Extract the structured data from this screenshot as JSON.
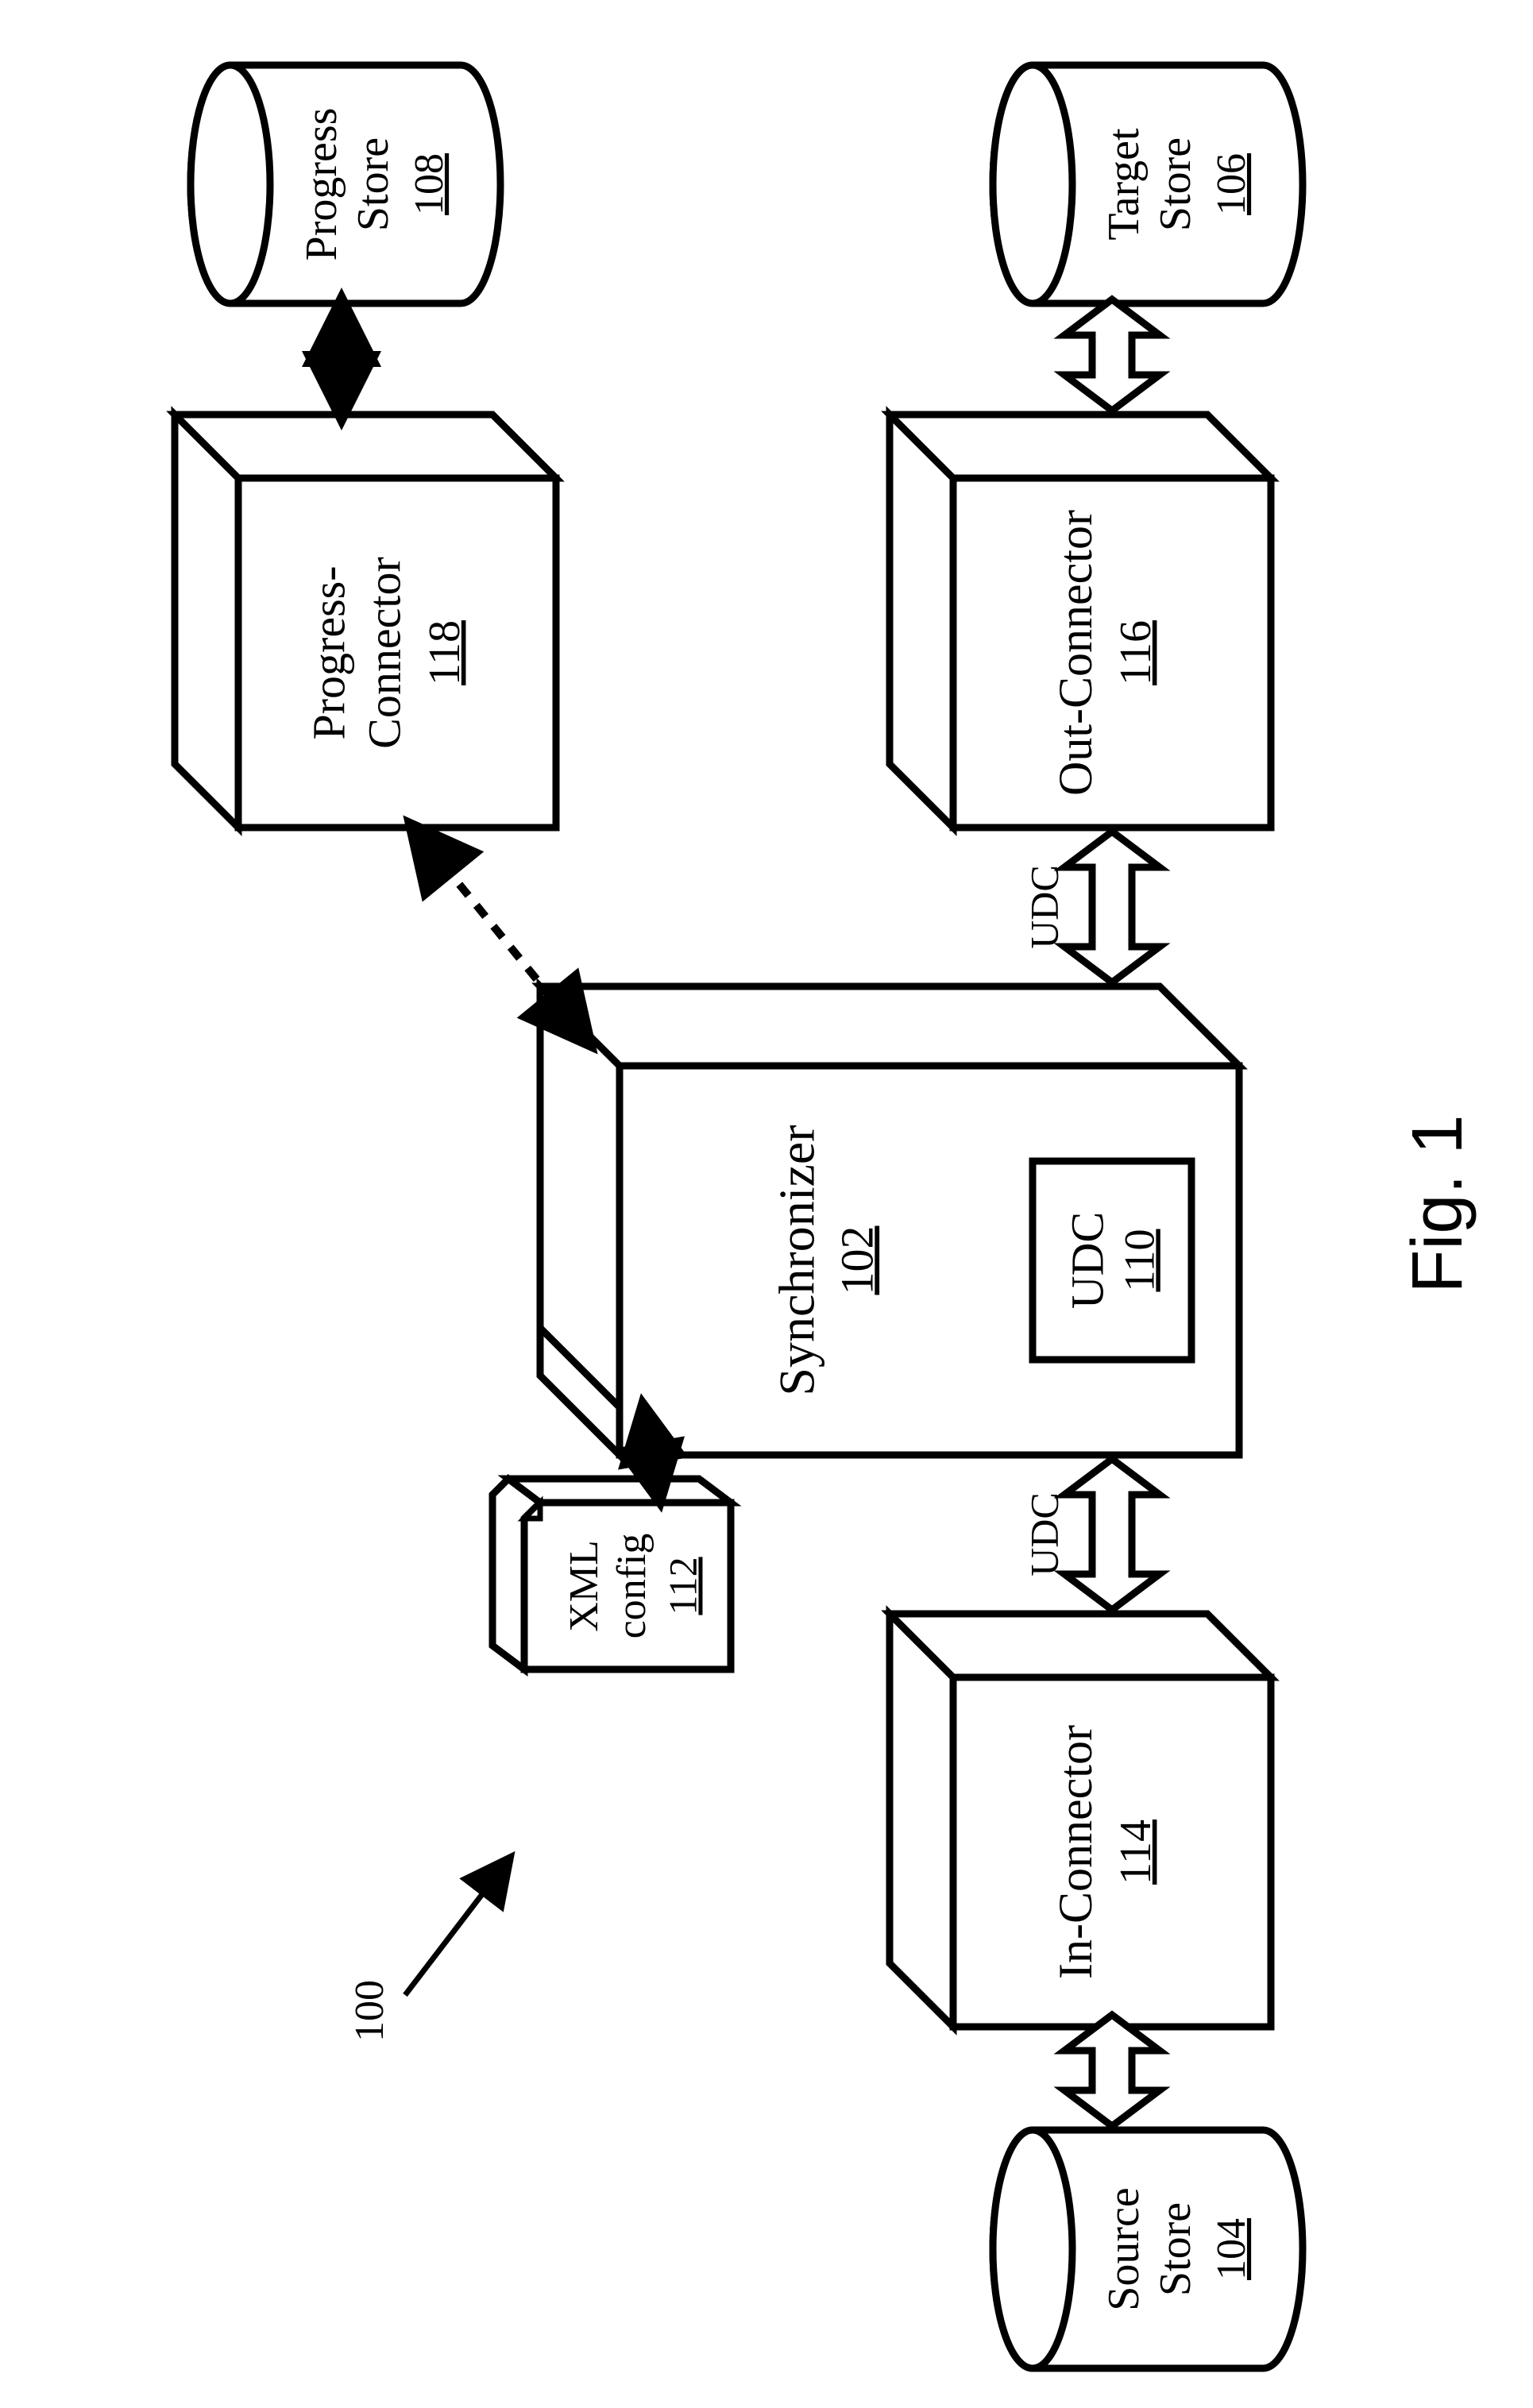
{
  "figure": {
    "caption": "Fig. 1",
    "ref_number": "100"
  },
  "nodes": {
    "synchronizer": {
      "label": "Synchronizer",
      "num": "102"
    },
    "udc_inner": {
      "label": "UDC",
      "num": "110"
    },
    "xml_config": {
      "label1": "XML",
      "label2": "config",
      "num": "112"
    },
    "in_connector": {
      "label": "In-Connector",
      "num": "114"
    },
    "out_connector": {
      "label": "Out-Connector",
      "num": "116"
    },
    "prog_connector": {
      "label1": "Progress-",
      "label2": "Connector",
      "num": "118"
    },
    "source_store": {
      "label1": "Source",
      "label2": "Store",
      "num": "104"
    },
    "target_store": {
      "label1": "Target",
      "label2": "Store",
      "num": "106"
    },
    "progress_store": {
      "label1": "Progress",
      "label2": "Store",
      "num": "108"
    }
  },
  "edges": {
    "udc_left": {
      "label": "UDC"
    },
    "udc_right": {
      "label": "UDC"
    }
  }
}
